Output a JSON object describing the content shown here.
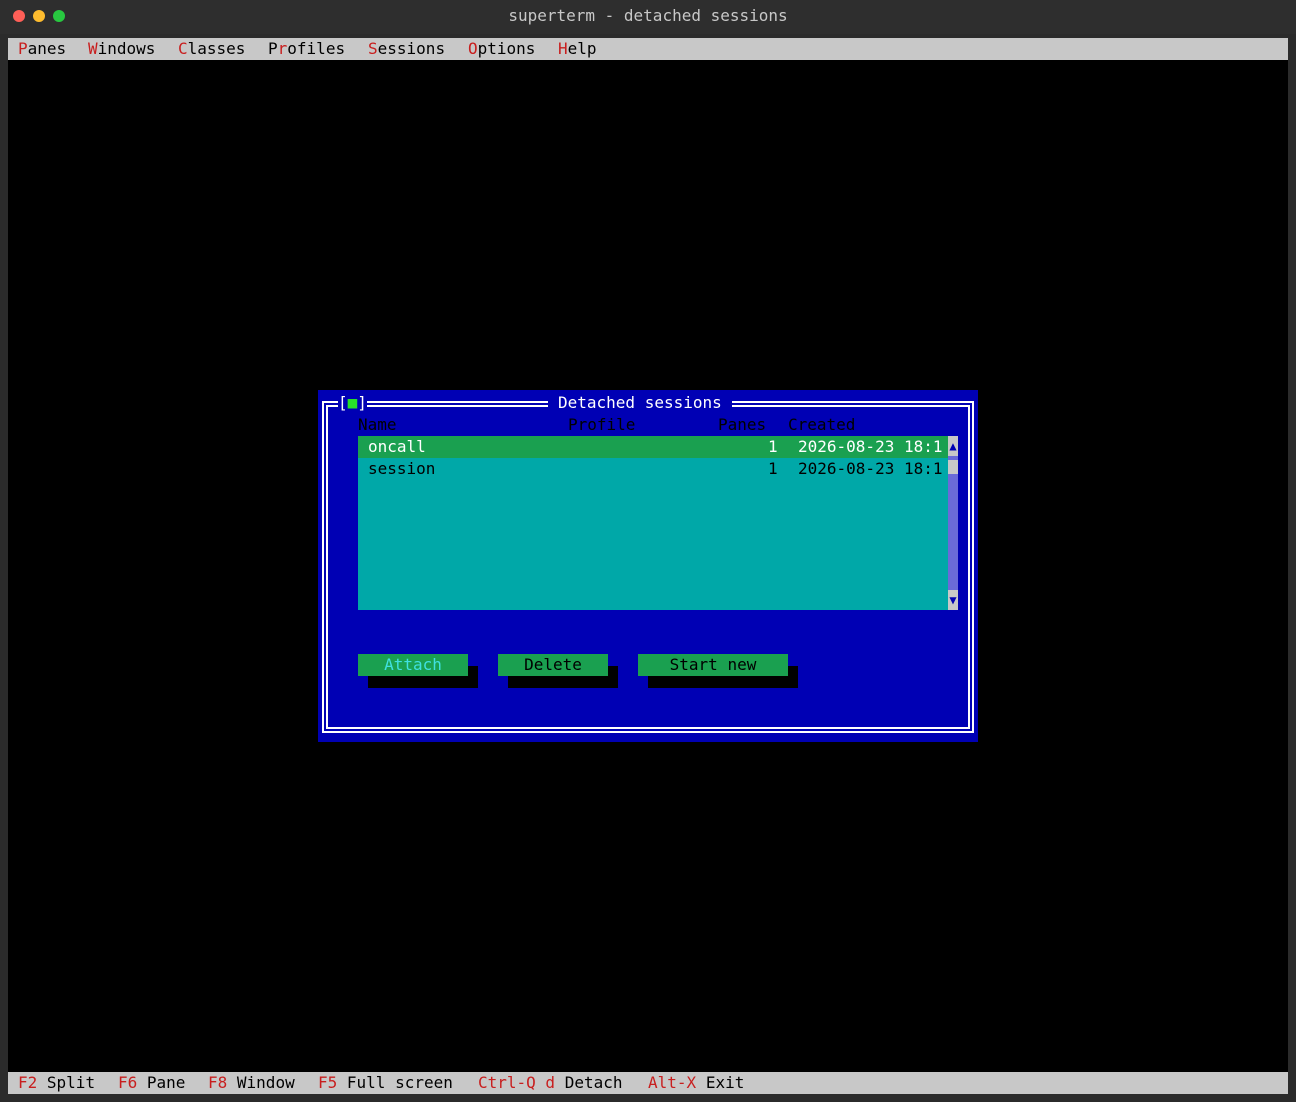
{
  "window": {
    "title": "superterm - detached sessions"
  },
  "menu": [
    {
      "hot": "P",
      "rest": "anes"
    },
    {
      "hot": "W",
      "rest": "indows"
    },
    {
      "hot": "C",
      "rest": "lasses"
    },
    {
      "pre": "P",
      "hot": "r",
      "rest": "ofiles"
    },
    {
      "hot": "S",
      "rest": "essions"
    },
    {
      "hot": "O",
      "rest": "ptions"
    },
    {
      "hot": "H",
      "rest": "elp"
    }
  ],
  "dialog": {
    "close_box_left": "[",
    "close_box_mark": "■",
    "close_box_right": "]",
    "title": "Detached sessions",
    "columns": {
      "name": "Name",
      "profile": "Profile",
      "panes": "Panes",
      "created": "Created"
    },
    "sessions": [
      {
        "name": "oncall",
        "profile": "",
        "panes": "1",
        "created": "2026-08-23 18:1",
        "selected": true
      },
      {
        "name": "session",
        "profile": "",
        "panes": "1",
        "created": "2026-08-23 18:1",
        "selected": false
      }
    ],
    "scroll_up": "▲",
    "scroll_down": "▼",
    "buttons": {
      "attach": "Attach",
      "delete": "Delete",
      "start_new": "Start new"
    }
  },
  "statusbar": [
    {
      "key": "F2",
      "label": "Split"
    },
    {
      "key": "F6",
      "label": "Pane"
    },
    {
      "key": "F8",
      "label": "Window"
    },
    {
      "key": "F5",
      "label": "Full screen"
    },
    {
      "key": "Ctrl-Q d",
      "label": "Detach"
    },
    {
      "key": "Alt-X",
      "label": "Exit"
    }
  ],
  "colors": {
    "dialog_bg": "#0000b4",
    "list_bg": "#00a8a8",
    "selection": "#1aa050",
    "hotkey": "#c81e1e"
  }
}
